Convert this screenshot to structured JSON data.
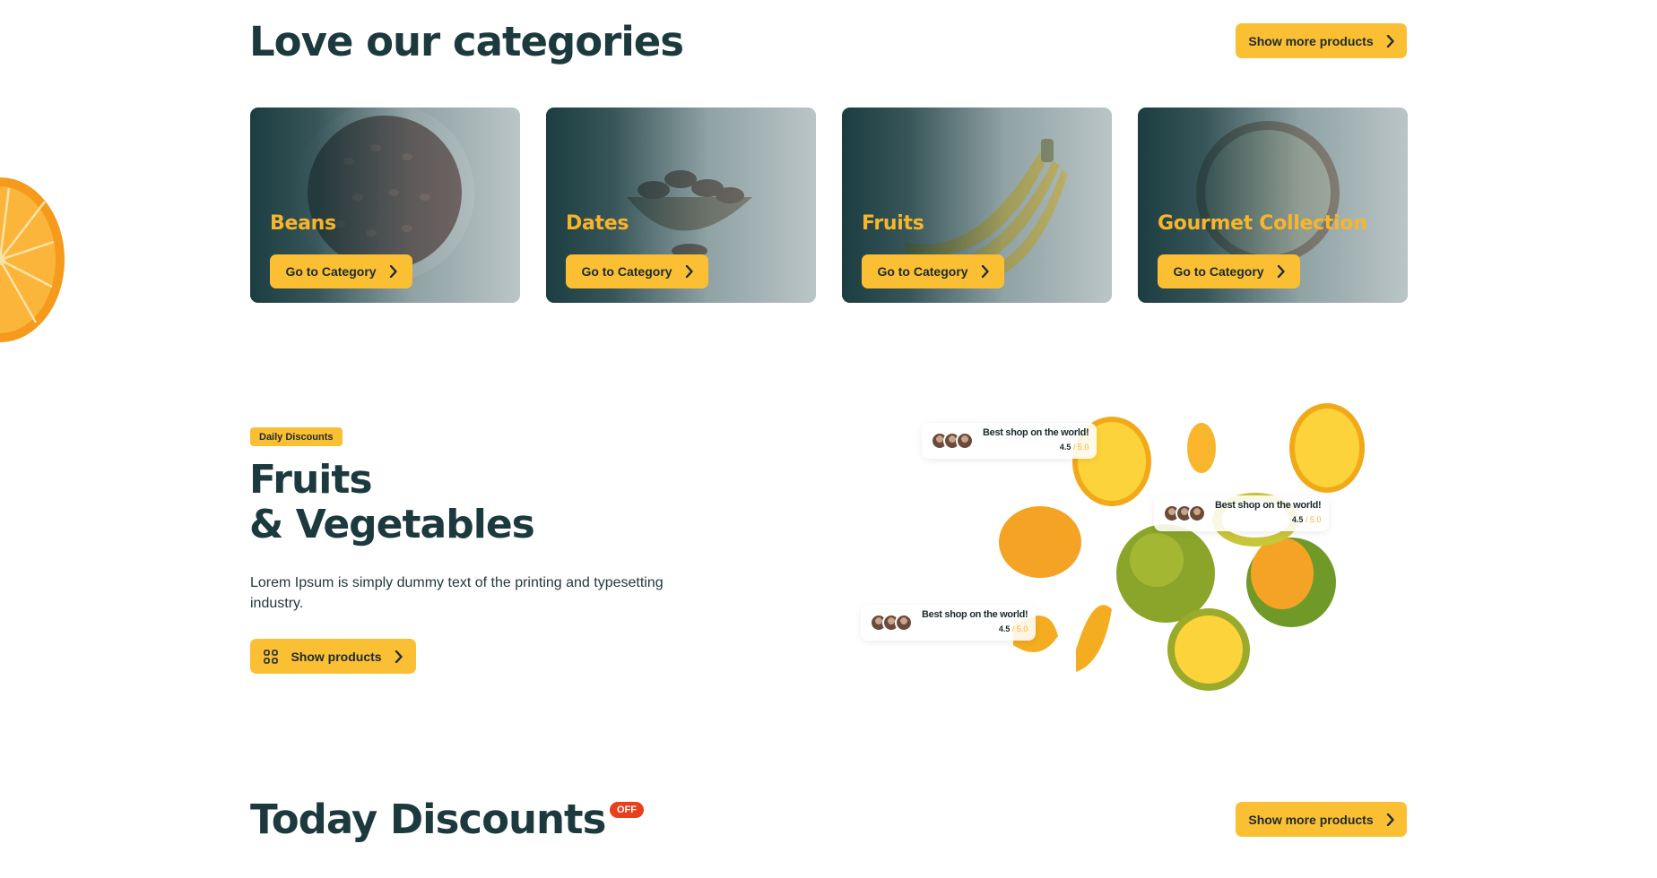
{
  "categories_section": {
    "title": "Love our categories",
    "more_button": "Show more products",
    "cards": [
      {
        "name": "Beans",
        "button": "Go to Category"
      },
      {
        "name": "Dates",
        "button": "Go to Category"
      },
      {
        "name": "Fruits",
        "button": "Go to Category"
      },
      {
        "name": "Gourmet Collection",
        "button": "Go to Category"
      }
    ]
  },
  "hero": {
    "badge": "Daily Discounts",
    "title_line1": "Fruits",
    "title_line2": "& Vegetables",
    "description": "Lorem Ipsum is simply dummy text of the printing and typesetting industry.",
    "button": "Show products",
    "rating_cards": [
      {
        "title": "Best shop on the world!",
        "score": "4.5",
        "max": " / 5.0"
      },
      {
        "title": "Best shop on the world!",
        "score": "4.5",
        "max": " / 5.0"
      },
      {
        "title": "Best shop on the world!",
        "score": "4.5",
        "max": " / 5.0"
      }
    ]
  },
  "discounts_section": {
    "title": "Today Discounts",
    "off_badge": "OFF",
    "more_button": "Show more products"
  },
  "colors": {
    "accent": "#fbbf34",
    "heading": "#1c3a3e",
    "off_badge": "#e8401c"
  }
}
